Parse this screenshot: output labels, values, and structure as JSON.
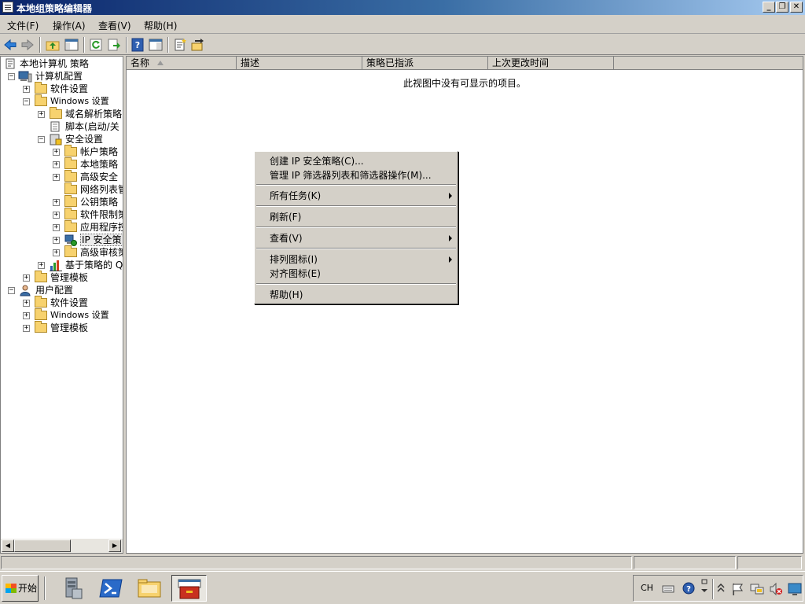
{
  "window": {
    "title": "本地组策略编辑器",
    "minimize_glyph": "_",
    "restore_glyph": "❐",
    "close_glyph": "✕"
  },
  "menu": [
    "文件(F)",
    "操作(A)",
    "查看(V)",
    "帮助(H)"
  ],
  "tree": {
    "root": "本地计算机 策略",
    "computer_config": "计算机配置",
    "cc_software": "软件设置",
    "cc_windows": "Windows 设置",
    "dns_policy": "域名解析策略",
    "scripts": "脚本(启动/关",
    "security_settings": "安全设置",
    "account_policy": "帐户策略",
    "local_policy": "本地策略",
    "advanced_security": "高级安全",
    "network_list": "网络列表管",
    "public_key": "公钥策略",
    "software_restriction": "软件限制策",
    "app_control": "应用程序控",
    "ip_security": "IP 安全策",
    "advanced_audit": "高级审核策",
    "qos": "基于策略的 Q",
    "cc_admin_templates": "管理模板",
    "user_config": "用户配置",
    "uc_software": "软件设置",
    "uc_windows": "Windows 设置",
    "uc_admin_templates": "管理模板",
    "expand_glyph": "+",
    "collapse_glyph": "−"
  },
  "columns": [
    "名称",
    "描述",
    "策略已指派",
    "上次更改时间"
  ],
  "empty_message": "此视图中没有可显示的项目。",
  "context_menu": {
    "create_ip_policy": "创建 IP 安全策略(C)...",
    "manage_filters": "管理 IP 筛选器列表和筛选器操作(M)...",
    "all_tasks": "所有任务(K)",
    "refresh": "刷新(F)",
    "view": "查看(V)",
    "arrange_icons": "排列图标(I)",
    "align_icons": "对齐图标(E)",
    "help": "帮助(H)"
  },
  "taskbar": {
    "start_label": "开始",
    "input_lang": "CH"
  }
}
